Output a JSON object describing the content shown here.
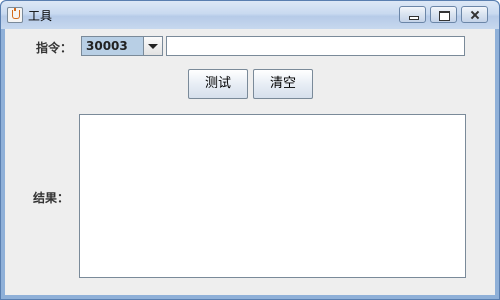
{
  "window": {
    "title": "工具"
  },
  "form": {
    "command_label": "指令：",
    "command_selected": "30003",
    "command_input_value": "",
    "result_label": "结果：",
    "result_value": ""
  },
  "buttons": {
    "test_label": "测试",
    "clear_label": "清空"
  },
  "icons": {
    "app": "java-cup-icon",
    "minimize": "minimize-icon",
    "maximize": "maximize-icon",
    "close": "close-icon",
    "dropdown": "chevron-down-icon"
  }
}
